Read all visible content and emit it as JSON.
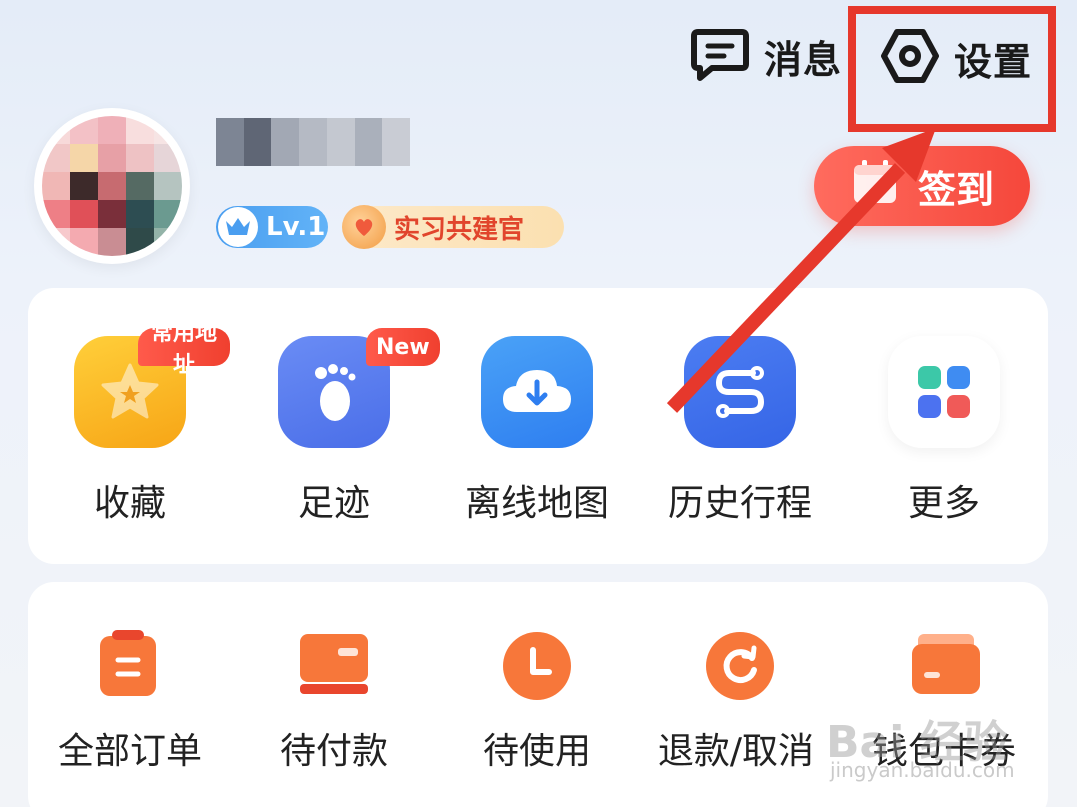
{
  "header": {
    "messages_label": "消息",
    "settings_label": "设置"
  },
  "profile": {
    "level_badge": "Lv.1",
    "title_badge": "实习共建官",
    "checkin_label": "签到"
  },
  "shortcuts": [
    {
      "label": "收藏",
      "icon": "star-icon",
      "tag": "常用地址"
    },
    {
      "label": "足迹",
      "icon": "footprint-icon",
      "tag": "New"
    },
    {
      "label": "离线地图",
      "icon": "cloud-download-icon"
    },
    {
      "label": "历史行程",
      "icon": "route-icon"
    },
    {
      "label": "更多",
      "icon": "grid-icon"
    }
  ],
  "orders": [
    {
      "label": "全部订单",
      "icon": "clipboard-icon"
    },
    {
      "label": "待付款",
      "icon": "card-icon"
    },
    {
      "label": "待使用",
      "icon": "clock-icon"
    },
    {
      "label": "退款/取消",
      "icon": "refresh-icon"
    },
    {
      "label": "钱包卡券",
      "icon": "wallet-icon"
    }
  ],
  "watermark": {
    "main": "Bai 经验",
    "sub": "jingyan.baidu.com"
  },
  "colors": {
    "accent_red": "#f5473b",
    "highlight": "#e6382c",
    "order_orange": "#f7773a",
    "blue_icon": "#3f7cf2"
  }
}
